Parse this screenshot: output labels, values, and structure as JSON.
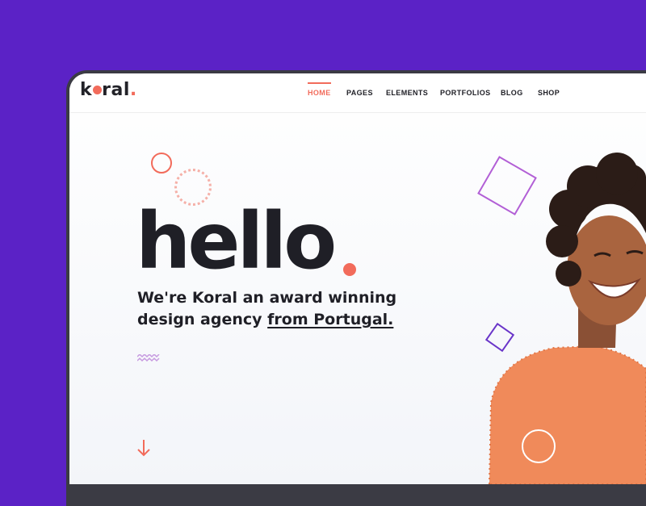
{
  "app": {
    "brand_name": "koral",
    "brand_letters": [
      "k",
      "ral",
      "."
    ]
  },
  "nav": {
    "items": [
      {
        "label": "HOME",
        "active": true
      },
      {
        "label": "PAGES",
        "active": false
      },
      {
        "label": "ELEMENTS",
        "active": false
      },
      {
        "label": "PORTFOLIOS",
        "active": false
      },
      {
        "label": "BLOG",
        "active": false
      },
      {
        "label": "SHOP",
        "active": false
      }
    ]
  },
  "hero": {
    "headline": "hello",
    "tagline_line1": "We're Koral an award winning",
    "tagline_line2_prefix": "design agency ",
    "tagline_link": "from Portugal."
  },
  "icons": {
    "scroll_down": "arrow-down-icon",
    "zigzag": "zigzag-decoration-icon"
  },
  "colors": {
    "background": "#5b22c6",
    "accent": "#f26b5b",
    "text": "#1f1f26",
    "square_decoration": "#b25fd6",
    "sweater": "#f08a5a"
  }
}
